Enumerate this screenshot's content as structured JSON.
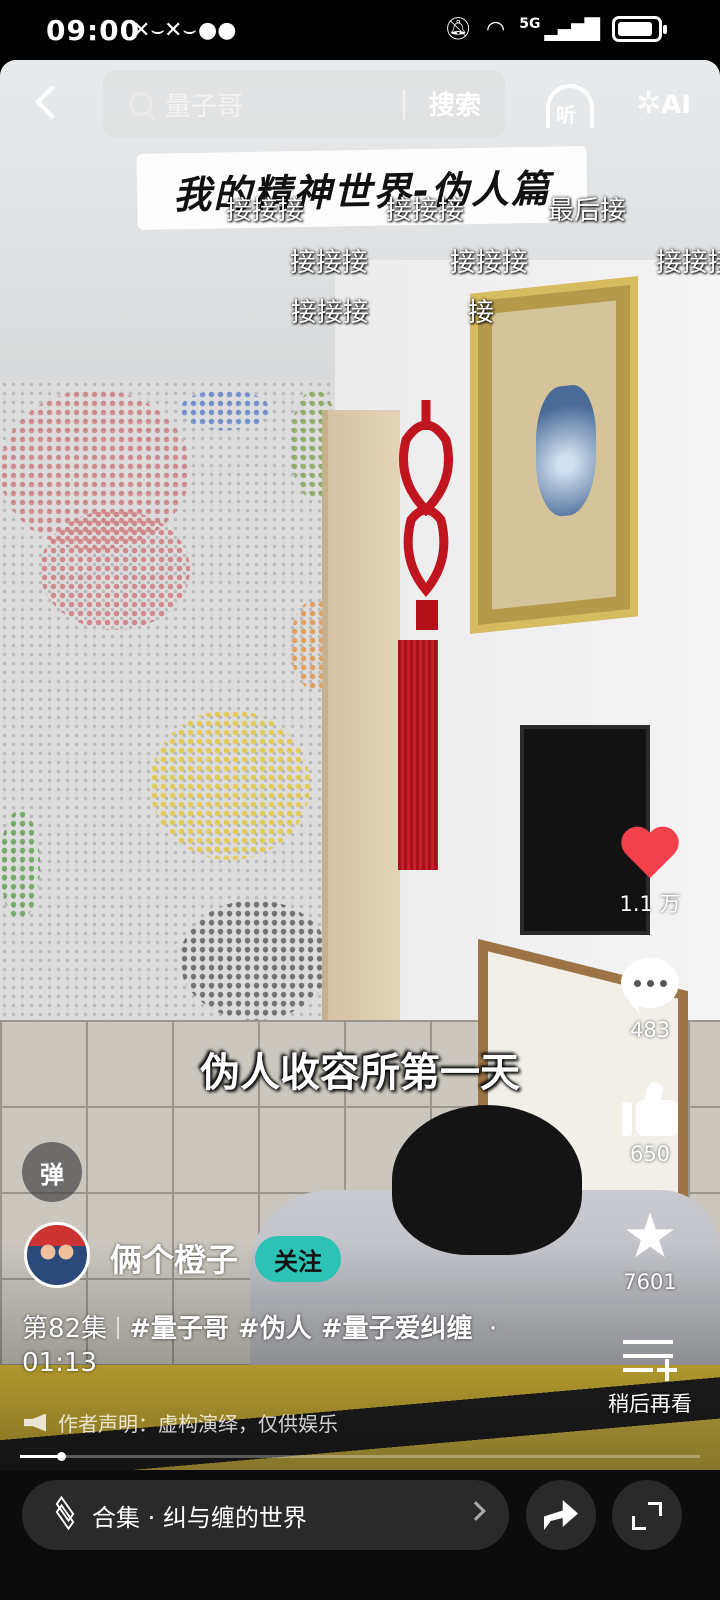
{
  "status_bar": {
    "time": "09:00",
    "network": "5G"
  },
  "search": {
    "query": "量子哥",
    "button": "搜索"
  },
  "top_actions": {
    "listen_label": "听",
    "ai_label": "AI"
  },
  "video": {
    "title_banner": "我的精神世界-伪人篇",
    "caption": "伪人收容所第一天",
    "danmaku": [
      "接接接",
      "接接接",
      "最后接",
      "接接接",
      "接接接",
      "接接接",
      "接接接",
      "接"
    ]
  },
  "actions": {
    "likes": "1.1 万",
    "comments": "483",
    "recommends": "650",
    "favorites": "7601",
    "watch_later": "稍后再看"
  },
  "danmaku_toggle": "弹",
  "author": {
    "name": "俩个橙子",
    "follow_label": "关注"
  },
  "description": {
    "episode": "第82集",
    "tags": "#量子哥 #伪人 #量子爱纠缠",
    "dot": "·",
    "duration": "01:13",
    "disclaimer": "作者声明：虚构演绎，仅供娱乐"
  },
  "progress": {
    "fraction": 0.06
  },
  "bottom": {
    "collection_label": "合集 · 纠与缠的世界"
  },
  "colors": {
    "like_red": "#f2414d",
    "follow_teal": "#2cc3b6"
  }
}
